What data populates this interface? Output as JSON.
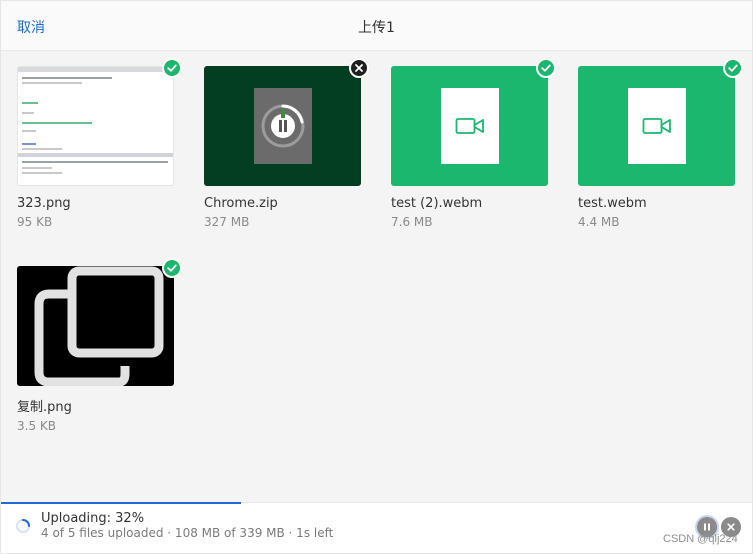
{
  "header": {
    "cancel_label": "取消",
    "title": "上传1"
  },
  "files": [
    {
      "name": "323.png",
      "size": "95 KB",
      "status": "done",
      "thumb": "screenshot"
    },
    {
      "name": "Chrome.zip",
      "size": "327 MB",
      "status": "uploading",
      "thumb": "archive"
    },
    {
      "name": "test (2).webm",
      "size": "7.6 MB",
      "status": "done",
      "thumb": "video"
    },
    {
      "name": "test.webm",
      "size": "4.4 MB",
      "status": "done",
      "thumb": "video"
    },
    {
      "name": "复制.png",
      "size": "3.5 KB",
      "status": "done",
      "thumb": "copy-image"
    }
  ],
  "status": {
    "title": "Uploading: 32%",
    "detail": "4 of 5 files uploaded · 108 MB of 339 MB · 1s left",
    "progress_percent": 32
  },
  "watermark": "CSDN @qlj224",
  "colors": {
    "accent": "#1d6ad6",
    "success": "#1bb76e",
    "video_bg": "#1bb76e",
    "archive_bg": "#033d22"
  },
  "icons": {
    "done_badge": "check-circle-icon",
    "remove_badge": "close-circle-icon",
    "video": "video-camera-icon",
    "pause": "pause-icon",
    "close": "close-icon",
    "spinner": "loading-spinner-icon"
  }
}
